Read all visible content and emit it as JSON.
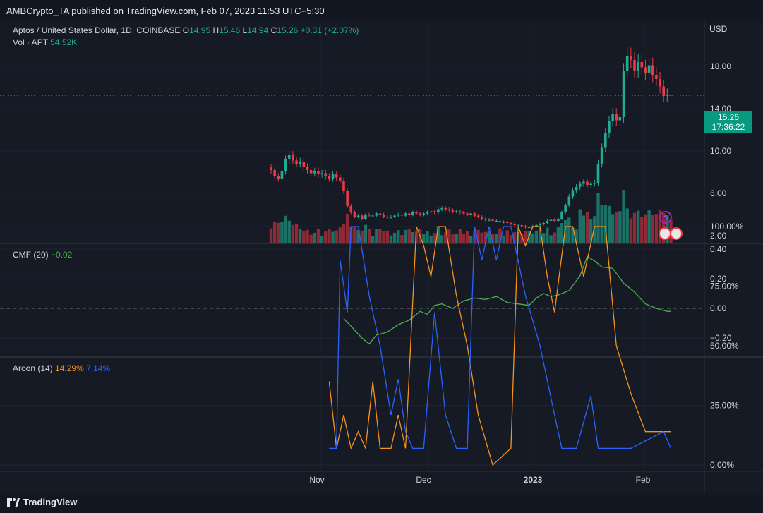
{
  "header": {
    "publisher_line": "AMBCrypto_TA published on TradingView.com, Feb 07, 2023 11:53 UTC+5:30"
  },
  "main_pane": {
    "symbol": "Aptos / United States Dollar, 1D, COINBASE",
    "o_label": "O",
    "o_value": "14.95",
    "h_label": "H",
    "h_value": "15.46",
    "l_label": "L",
    "l_value": "14.94",
    "c_label": "C",
    "c_value": "15.26",
    "change": "+0.31 (+2.07%)",
    "vol_label": "Vol · APT",
    "vol_value": "54.52K",
    "currency": "USD",
    "price_tag": {
      "price": "15.26",
      "countdown": "17:36:22"
    },
    "axis_ticks": [
      "18.00",
      "14.00",
      "10.00",
      "6.00",
      "2.00"
    ]
  },
  "cmf_pane": {
    "label": "CMF (20)",
    "value": "−0.02",
    "axis_ticks": [
      "0.40",
      "0.20",
      "0.00",
      "−0.20"
    ]
  },
  "aroon_pane": {
    "label": "Aroon (14)",
    "up_value": "14.29%",
    "down_value": "7.14%",
    "axis_ticks": [
      "100.00%",
      "75.00%",
      "50.00%",
      "25.00%",
      "0.00%"
    ]
  },
  "time_axis": [
    "Nov",
    "Dec",
    "2023",
    "Feb"
  ],
  "footer": {
    "brand": "TradingView"
  },
  "colors": {
    "up": "#22ab94",
    "down": "#f23645",
    "cmf": "#4caf50",
    "aroon_up": "#f7931a",
    "aroon_down": "#2962ff",
    "bg": "#161a25"
  },
  "chart_data": [
    {
      "type": "candlestick",
      "title": "Aptos / United States Dollar, 1D, COINBASE",
      "ylabel": "USD",
      "ylim": [
        0,
        20
      ],
      "x_range": [
        "2022-10-19",
        "2023-02-07"
      ],
      "close_approx": [
        [
          0,
          8.2
        ],
        [
          1,
          7.6
        ],
        [
          2,
          7.4
        ],
        [
          3,
          8.1
        ],
        [
          4,
          9.2
        ],
        [
          5,
          9.6
        ],
        [
          6,
          9.1
        ],
        [
          7,
          8.8
        ],
        [
          8,
          9.0
        ],
        [
          9,
          8.5
        ],
        [
          10,
          8.2
        ],
        [
          11,
          7.9
        ],
        [
          12,
          8.1
        ],
        [
          13,
          7.8
        ],
        [
          14,
          7.9
        ],
        [
          15,
          7.6
        ],
        [
          16,
          7.4
        ],
        [
          17,
          7.8
        ],
        [
          18,
          7.5
        ],
        [
          19,
          7.2
        ],
        [
          20,
          6.2
        ],
        [
          21,
          4.8
        ],
        [
          22,
          4.2
        ],
        [
          23,
          3.8
        ],
        [
          24,
          3.9
        ],
        [
          25,
          3.6
        ],
        [
          26,
          4.0
        ],
        [
          27,
          3.9
        ],
        [
          28,
          3.9
        ],
        [
          29,
          4.1
        ],
        [
          30,
          4.0
        ],
        [
          31,
          3.8
        ],
        [
          32,
          3.7
        ],
        [
          33,
          3.8
        ],
        [
          34,
          3.9
        ],
        [
          35,
          4.0
        ],
        [
          36,
          3.9
        ],
        [
          37,
          4.1
        ],
        [
          38,
          4.0
        ],
        [
          39,
          4.2
        ],
        [
          40,
          4.1
        ],
        [
          41,
          4.0
        ],
        [
          42,
          4.1
        ],
        [
          43,
          4.2
        ],
        [
          44,
          4.3
        ],
        [
          45,
          4.2
        ],
        [
          46,
          4.5
        ],
        [
          47,
          4.6
        ],
        [
          48,
          4.5
        ],
        [
          49,
          4.4
        ],
        [
          50,
          4.3
        ],
        [
          51,
          4.3
        ],
        [
          52,
          4.2
        ],
        [
          53,
          4.1
        ],
        [
          54,
          4.0
        ],
        [
          55,
          4.1
        ],
        [
          56,
          3.9
        ],
        [
          57,
          3.8
        ],
        [
          58,
          3.6
        ],
        [
          59,
          3.5
        ],
        [
          60,
          3.5
        ],
        [
          61,
          3.4
        ],
        [
          62,
          3.4
        ],
        [
          63,
          3.3
        ],
        [
          64,
          3.3
        ],
        [
          65,
          3.2
        ],
        [
          66,
          3.1
        ],
        [
          67,
          3.0
        ],
        [
          68,
          3.0
        ],
        [
          69,
          2.9
        ],
        [
          70,
          2.8
        ],
        [
          71,
          2.8
        ],
        [
          72,
          2.9
        ],
        [
          73,
          3.0
        ],
        [
          74,
          3.1
        ],
        [
          75,
          3.2
        ],
        [
          76,
          3.4
        ],
        [
          77,
          3.5
        ],
        [
          78,
          3.4
        ],
        [
          79,
          3.6
        ],
        [
          80,
          4.2
        ],
        [
          81,
          4.9
        ],
        [
          82,
          5.7
        ],
        [
          83,
          6.3
        ],
        [
          84,
          6.6
        ],
        [
          85,
          6.9
        ],
        [
          86,
          7.1
        ],
        [
          87,
          6.8
        ],
        [
          88,
          6.9
        ],
        [
          89,
          7.0
        ],
        [
          90,
          8.8
        ],
        [
          91,
          10.3
        ],
        [
          92,
          11.7
        ],
        [
          93,
          12.8
        ],
        [
          94,
          13.5
        ],
        [
          95,
          12.9
        ],
        [
          96,
          13.2
        ],
        [
          97,
          17.6
        ],
        [
          98,
          19.0
        ],
        [
          99,
          18.6
        ],
        [
          100,
          17.6
        ],
        [
          101,
          18.4
        ],
        [
          102,
          17.9
        ],
        [
          103,
          17.4
        ],
        [
          104,
          18.1
        ],
        [
          105,
          17.2
        ],
        [
          106,
          16.8
        ],
        [
          107,
          16.1
        ],
        [
          108,
          15.2
        ],
        [
          109,
          15.3
        ],
        [
          110,
          15.26
        ]
      ]
    },
    {
      "type": "line",
      "title": "CMF (20)",
      "ylim": [
        -0.3,
        0.45
      ],
      "series": [
        {
          "name": "CMF (20)",
          "values_approx": [
            [
              20,
              -0.07
            ],
            [
              22,
              -0.12
            ],
            [
              25,
              -0.2
            ],
            [
              27,
              -0.24
            ],
            [
              29,
              -0.18
            ],
            [
              32,
              -0.16
            ],
            [
              35,
              -0.11
            ],
            [
              38,
              -0.08
            ],
            [
              41,
              -0.02
            ],
            [
              43,
              -0.04
            ],
            [
              45,
              0.02
            ],
            [
              47,
              0.03
            ],
            [
              50,
              0.0
            ],
            [
              53,
              0.05
            ],
            [
              56,
              0.07
            ],
            [
              59,
              0.06
            ],
            [
              62,
              0.08
            ],
            [
              65,
              0.04
            ],
            [
              68,
              0.03
            ],
            [
              71,
              0.02
            ],
            [
              73,
              0.07
            ],
            [
              75,
              0.1
            ],
            [
              77,
              0.08
            ],
            [
              79,
              0.09
            ],
            [
              82,
              0.12
            ],
            [
              85,
              0.22
            ],
            [
              87,
              0.35
            ],
            [
              89,
              0.32
            ],
            [
              91,
              0.28
            ],
            [
              94,
              0.27
            ],
            [
              97,
              0.17
            ],
            [
              100,
              0.11
            ],
            [
              103,
              0.03
            ],
            [
              106,
              0.0
            ],
            [
              109,
              -0.02
            ],
            [
              110,
              -0.02
            ]
          ]
        }
      ]
    },
    {
      "type": "line",
      "title": "Aroon (14)",
      "ylim": [
        0,
        100
      ],
      "series": [
        {
          "name": "Aroon Up",
          "values_approx": [
            [
              16,
              35
            ],
            [
              18,
              7
            ],
            [
              20,
              21
            ],
            [
              22,
              7
            ],
            [
              24,
              14
            ],
            [
              26,
              7
            ],
            [
              28,
              35
            ],
            [
              30,
              7
            ],
            [
              33,
              7
            ],
            [
              35,
              21
            ],
            [
              37,
              7
            ],
            [
              40,
              100
            ],
            [
              42,
              92
            ],
            [
              44,
              79
            ],
            [
              46,
              100
            ],
            [
              48,
              100
            ],
            [
              51,
              71
            ],
            [
              54,
              50
            ],
            [
              57,
              21
            ],
            [
              61,
              0
            ],
            [
              66,
              7
            ],
            [
              68,
              100
            ],
            [
              70,
              92
            ],
            [
              72,
              100
            ],
            [
              74,
              100
            ],
            [
              76,
              79
            ],
            [
              78,
              64
            ],
            [
              81,
              100
            ],
            [
              83,
              100
            ],
            [
              86,
              79
            ],
            [
              89,
              100
            ],
            [
              92,
              100
            ],
            [
              95,
              50
            ],
            [
              99,
              30
            ],
            [
              103,
              14
            ],
            [
              110,
              14
            ]
          ]
        },
        {
          "name": "Aroon Down",
          "values_approx": [
            [
              16,
              7
            ],
            [
              18,
              7
            ],
            [
              19,
              86
            ],
            [
              21,
              64
            ],
            [
              22,
              100
            ],
            [
              24,
              100
            ],
            [
              27,
              71
            ],
            [
              30,
              50
            ],
            [
              33,
              21
            ],
            [
              35,
              36
            ],
            [
              37,
              14
            ],
            [
              39,
              7
            ],
            [
              42,
              7
            ],
            [
              45,
              64
            ],
            [
              48,
              21
            ],
            [
              51,
              7
            ],
            [
              54,
              7
            ],
            [
              56,
              100
            ],
            [
              58,
              86
            ],
            [
              60,
              100
            ],
            [
              62,
              86
            ],
            [
              64,
              100
            ],
            [
              66,
              100
            ],
            [
              70,
              71
            ],
            [
              74,
              50
            ],
            [
              78,
              21
            ],
            [
              80,
              7
            ],
            [
              84,
              7
            ],
            [
              88,
              29
            ],
            [
              90,
              7
            ],
            [
              95,
              7
            ],
            [
              99,
              7
            ],
            [
              108,
              14
            ],
            [
              110,
              7
            ]
          ]
        }
      ]
    }
  ]
}
